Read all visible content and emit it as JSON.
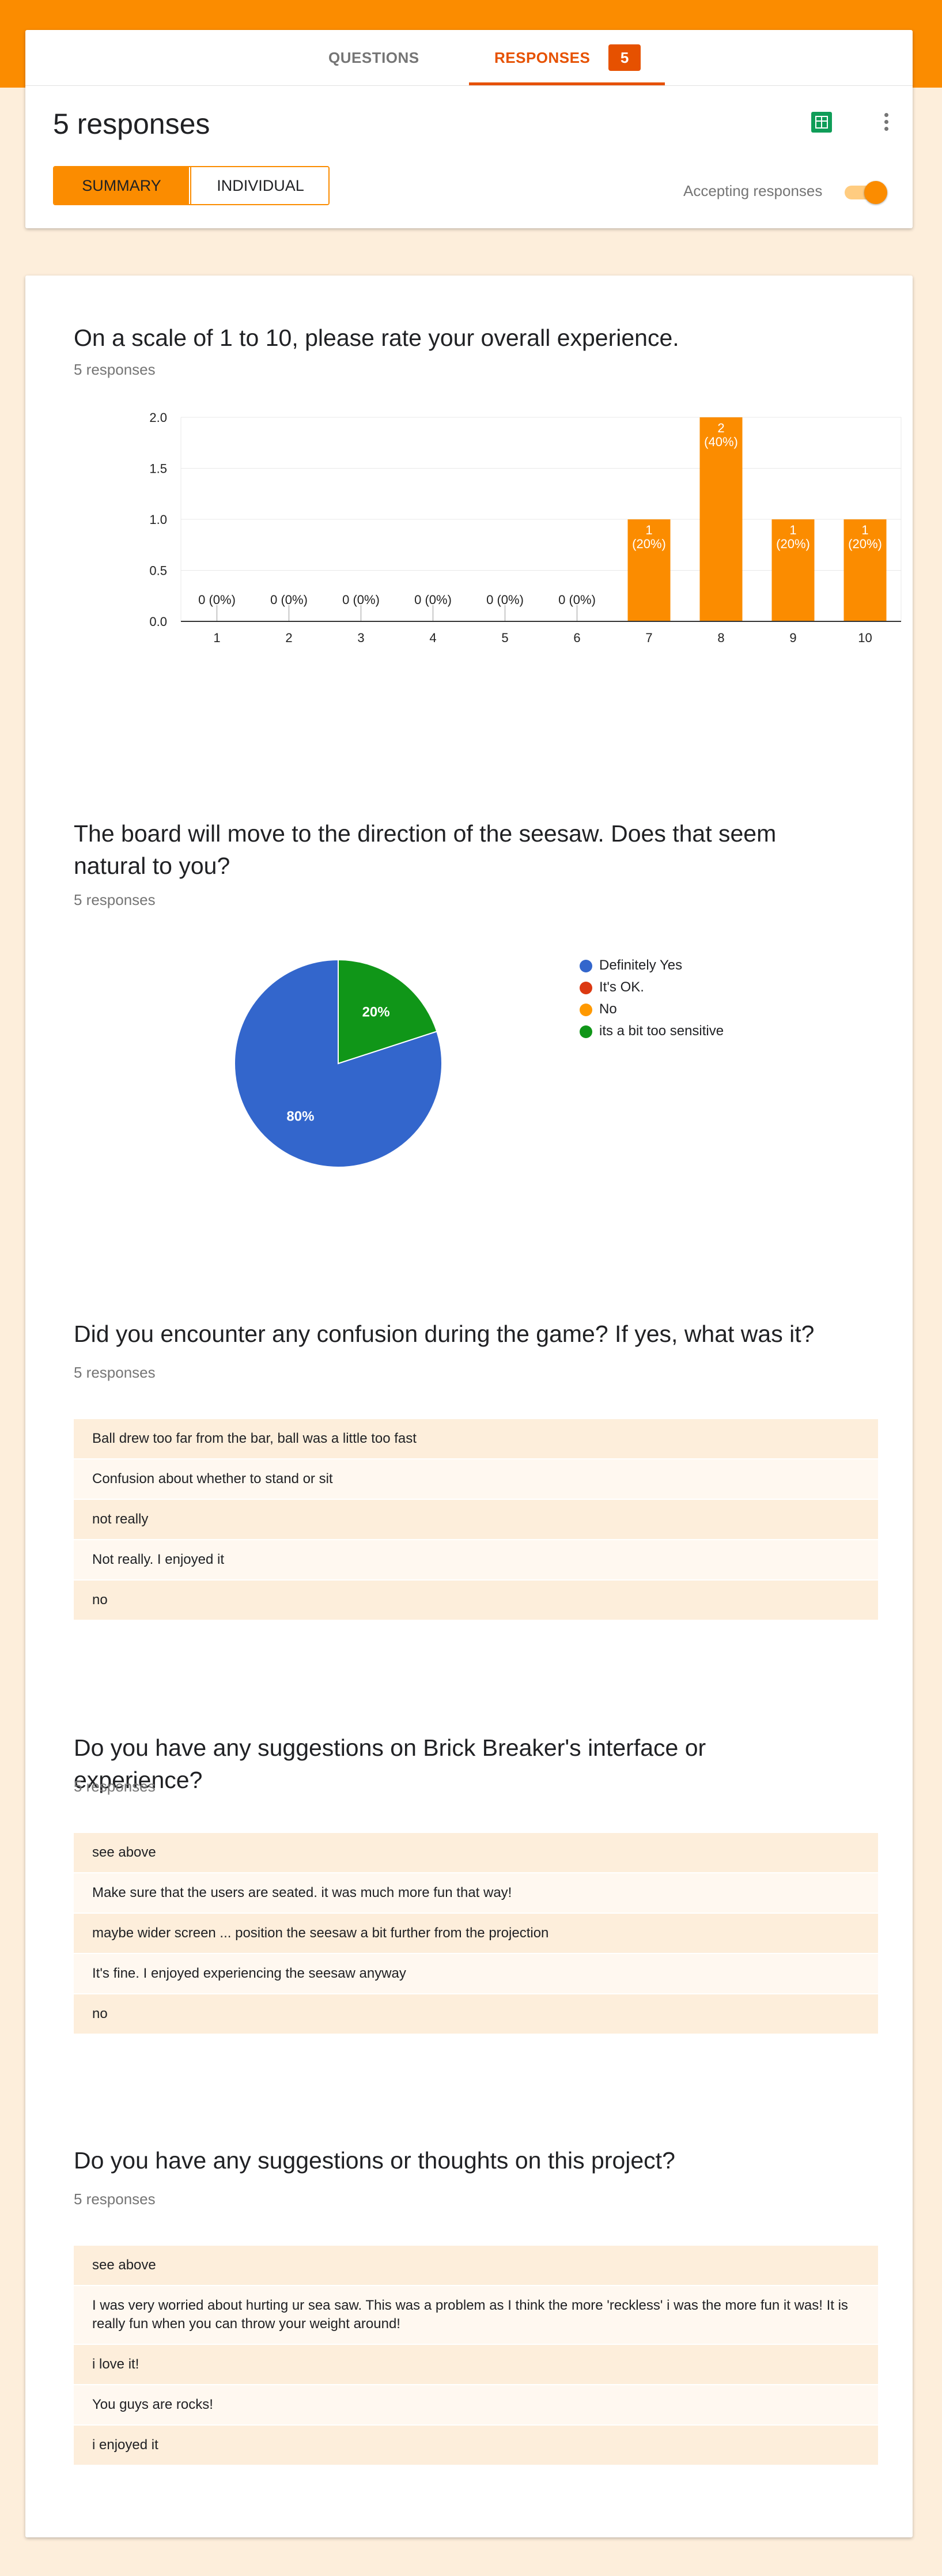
{
  "header": {
    "tabs": [
      {
        "label": "QUESTIONS"
      },
      {
        "label": "RESPONSES",
        "count": "5"
      }
    ],
    "title": "5 responses",
    "view_toggle": {
      "summary": "SUMMARY",
      "individual": "INDIVIDUAL",
      "selected": "SUMMARY"
    },
    "accepting_label": "Accepting responses",
    "accepting_on": true,
    "icons": [
      "sheets-icon",
      "more-vert-icon"
    ],
    "accent_color": "#fb8c00"
  },
  "questions": [
    {
      "title": "On a scale of 1 to 10, please rate your overall experience.",
      "count": "5 responses"
    },
    {
      "title": "The board will move to the direction of the seesaw. Does that seem natural to you?",
      "count": "5 responses"
    },
    {
      "title": "Did you encounter any confusion during the game? If yes, what was it?",
      "count": "5 responses",
      "answers": [
        "Ball drew too far from the bar, ball was a little too fast",
        "Confusion about whether to stand or sit",
        "not really",
        "Not really. I enjoyed it",
        "no"
      ]
    },
    {
      "title": "Do you have any suggestions on Brick Breaker's interface or experience?",
      "count": "5 responses",
      "answers": [
        "see above",
        "Make sure that the users are seated. it was much more fun that way!",
        "maybe wider screen ... position the seesaw a bit further from the projection",
        "It's fine. I enjoyed experiencing the seesaw anyway",
        "no"
      ]
    },
    {
      "title": "Do you have any suggestions or thoughts on this project?",
      "count": "5 responses",
      "answers": [
        "see above",
        "I was very worried about hurting ur sea saw. This was a problem as I think the more 'reckless' i was the more fun it was! It is really fun when you can throw your weight around!",
        "i love it!",
        "You guys are rocks!",
        "i enjoyed it"
      ]
    }
  ],
  "chart_data": [
    {
      "type": "bar",
      "categories": [
        "1",
        "2",
        "3",
        "4",
        "5",
        "6",
        "7",
        "8",
        "9",
        "10"
      ],
      "values": [
        0,
        0,
        0,
        0,
        0,
        0,
        1,
        2,
        1,
        1
      ],
      "data_labels": [
        "0 (0%)",
        "0 (0%)",
        "0 (0%)",
        "0 (0%)",
        "0 (0%)",
        "0 (0%)",
        "1 (20%)",
        "2 (40%)",
        "1 (20%)",
        "1 (20%)"
      ],
      "y_ticks": [
        "0.0",
        "0.5",
        "1.0",
        "1.5",
        "2.0"
      ],
      "ylim": [
        0,
        2
      ],
      "grid": true,
      "color": "#fb8c00"
    },
    {
      "type": "pie",
      "categories": [
        "Definitely Yes",
        "It's OK.",
        "No",
        "its a bit too sensitive"
      ],
      "values": [
        80,
        0,
        0,
        20
      ],
      "slice_labels": [
        "80%",
        "",
        "",
        "20%"
      ],
      "colors": [
        "#3366cc",
        "#dc3912",
        "#ff9900",
        "#109618"
      ],
      "legend": "right"
    }
  ]
}
